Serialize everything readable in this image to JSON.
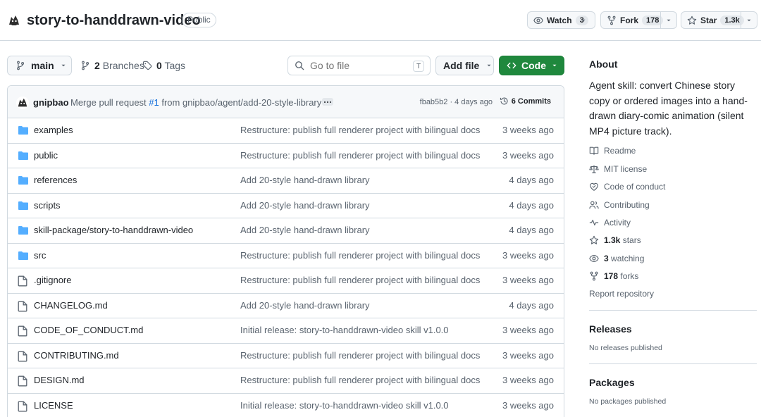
{
  "repo": {
    "name": "story-to-handdrawn-video",
    "visibility": "Public"
  },
  "header_actions": {
    "watch": {
      "label": "Watch",
      "count": "3"
    },
    "fork": {
      "label": "Fork",
      "count": "178"
    },
    "star": {
      "label": "Star",
      "count": "1.3k"
    }
  },
  "toolbar": {
    "branch": "main",
    "branches_count": "2",
    "branches_label": "Branches",
    "tags_count": "0",
    "tags_label": "Tags",
    "search_placeholder": "Go to file",
    "search_shortcut": "T",
    "add_file_label": "Add file",
    "code_label": "Code"
  },
  "latest_commit": {
    "author": "gnipbao",
    "message_prefix": "Merge pull request ",
    "pr_link": "#1",
    "message_suffix": " from gnipbao/agent/add-20-style-library",
    "hash_time": "fbab5b2 · 4 days ago",
    "commits_label": "6 Commits"
  },
  "files": [
    {
      "type": "dir",
      "name": "examples",
      "message": "Restructure: publish full renderer project with bilingual docs",
      "date": "3 weeks ago"
    },
    {
      "type": "dir",
      "name": "public",
      "message": "Restructure: publish full renderer project with bilingual docs",
      "date": "3 weeks ago"
    },
    {
      "type": "dir",
      "name": "references",
      "message": "Add 20-style hand-drawn library",
      "date": "4 days ago"
    },
    {
      "type": "dir",
      "name": "scripts",
      "message": "Add 20-style hand-drawn library",
      "date": "4 days ago"
    },
    {
      "type": "dir",
      "name": "skill-package/story-to-handdrawn-video",
      "message": "Add 20-style hand-drawn library",
      "date": "4 days ago"
    },
    {
      "type": "dir",
      "name": "src",
      "message": "Restructure: publish full renderer project with bilingual docs",
      "date": "3 weeks ago"
    },
    {
      "type": "file",
      "name": ".gitignore",
      "message": "Restructure: publish full renderer project with bilingual docs",
      "date": "3 weeks ago"
    },
    {
      "type": "file",
      "name": "CHANGELOG.md",
      "message": "Add 20-style hand-drawn library",
      "date": "4 days ago"
    },
    {
      "type": "file",
      "name": "CODE_OF_CONDUCT.md",
      "message": "Initial release: story-to-handdrawn-video skill v1.0.0",
      "date": "3 weeks ago"
    },
    {
      "type": "file",
      "name": "CONTRIBUTING.md",
      "message": "Restructure: publish full renderer project with bilingual docs",
      "date": "3 weeks ago"
    },
    {
      "type": "file",
      "name": "DESIGN.md",
      "message": "Restructure: publish full renderer project with bilingual docs",
      "date": "3 weeks ago"
    },
    {
      "type": "file",
      "name": "LICENSE",
      "message": "Initial release: story-to-handdrawn-video skill v1.0.0",
      "date": "3 weeks ago"
    }
  ],
  "about": {
    "heading": "About",
    "description": "Agent skill: convert Chinese story copy or ordered images into a hand-drawn diary-comic animation (silent MP4 picture track).",
    "links": {
      "readme": "Readme",
      "license": "MIT license",
      "conduct": "Code of conduct",
      "contributing": "Contributing",
      "activity": "Activity",
      "stars_count": "1.3k",
      "stars_label": "stars",
      "watching_count": "3",
      "watching_label": "watching",
      "forks_count": "178",
      "forks_label": "forks",
      "report": "Report repository"
    }
  },
  "releases": {
    "heading": "Releases",
    "note": "No releases published"
  },
  "packages": {
    "heading": "Packages",
    "note": "No packages published"
  },
  "colors": {
    "accent_green": "#1f883d",
    "folder_blue": "#54aeff",
    "link_blue": "#0969da",
    "muted_text": "#59636e",
    "border": "#d1d9e0"
  }
}
